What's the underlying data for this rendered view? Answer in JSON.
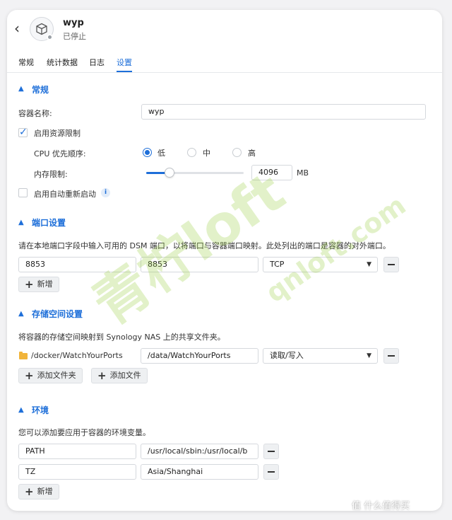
{
  "header": {
    "title": "wyp",
    "status": "已停止"
  },
  "tabs": [
    {
      "label": "常规"
    },
    {
      "label": "统计数据"
    },
    {
      "label": "日志"
    },
    {
      "label": "设置"
    }
  ],
  "general": {
    "section_title": "常规",
    "container_name_label": "容器名称:",
    "container_name_value": "wyp",
    "resource_limit_label": "启用资源限制",
    "cpu_priority_label": "CPU 优先顺序:",
    "cpu_options": [
      "低",
      "中",
      "高"
    ],
    "cpu_selected": "低",
    "memory_limit_label": "内存限制:",
    "memory_value": "4096",
    "memory_unit": "MB",
    "memory_fraction": 0.24,
    "auto_restart_label": "启用自动重新启动",
    "info_icon_glyph": "i"
  },
  "ports": {
    "section_title": "端口设置",
    "description": "请在本地端口字段中输入可用的 DSM 端口，以将端口与容器端口映射。此处列出的端口是容器的对外端口。",
    "rows": [
      {
        "local": "8853",
        "container": "8853",
        "protocol": "TCP"
      }
    ],
    "add_label": "新增"
  },
  "storage": {
    "section_title": "存储空间设置",
    "description": "将容器的存储空间映射到 Synology NAS 上的共享文件夹。",
    "rows": [
      {
        "folder": "/docker/WatchYourPorts",
        "mount": "/data/WatchYourPorts",
        "mode": "读取/写入"
      }
    ],
    "add_folder_label": "添加文件夹",
    "add_file_label": "添加文件"
  },
  "env": {
    "section_title": "环境",
    "description": "您可以添加要应用于容器的环境变量。",
    "rows": [
      {
        "name": "PATH",
        "value": "/usr/local/sbin:/usr/local/b"
      },
      {
        "name": "TZ",
        "value": "Asia/Shanghai"
      }
    ],
    "add_label": "新增"
  },
  "watermark": {
    "brand": "青柠loft",
    "url": "qnloft.com",
    "corner": "值 什么值得买"
  },
  "colors": {
    "accent": "#1e6fd9",
    "folder": "#f1b43a"
  }
}
